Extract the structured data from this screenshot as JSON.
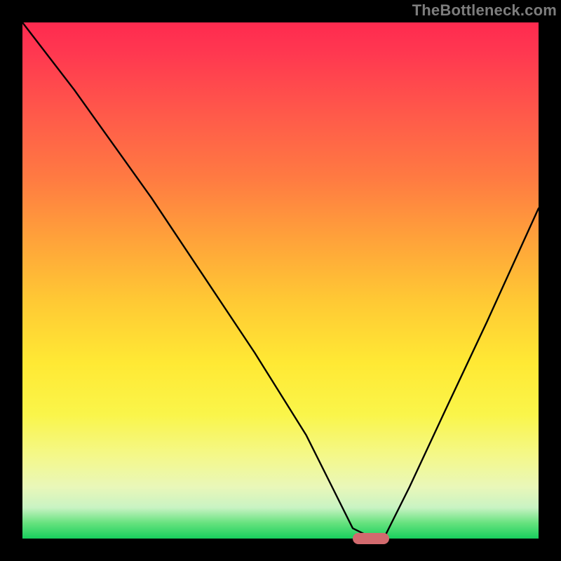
{
  "watermark": "TheBottleneck.com",
  "colors": {
    "black": "#000000",
    "curve": "#000000",
    "marker": "#d26a6e",
    "watermark": "#7d7d7d",
    "gradient_top": "#ff2a4f",
    "gradient_bottom": "#18cf5d"
  },
  "chart_data": {
    "type": "line",
    "title": "",
    "xlabel": "",
    "ylabel": "",
    "xlim": [
      0,
      100
    ],
    "ylim": [
      0,
      100
    ],
    "grid": false,
    "legend": false,
    "series": [
      {
        "name": "bottleneck-curve",
        "x": [
          0,
          10,
          20,
          25,
          35,
          45,
          55,
          60,
          64,
          68,
          70,
          75,
          82,
          90,
          100
        ],
        "values": [
          100,
          87,
          73,
          66,
          51,
          36,
          20,
          10,
          2,
          0,
          0,
          10,
          25,
          42,
          64
        ]
      }
    ],
    "annotations": [
      {
        "name": "optimal-marker",
        "shape": "rounded-bar",
        "x_start": 64,
        "x_end": 71,
        "y": 0
      }
    ],
    "background": "vertical-gradient-red-to-green"
  }
}
